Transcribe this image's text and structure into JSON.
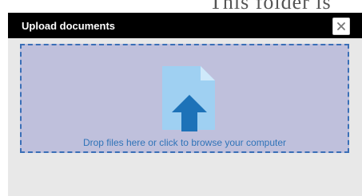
{
  "background": {
    "partial_text": "This folder is"
  },
  "dialog": {
    "title": "Upload documents",
    "close_label": "×"
  },
  "dropzone": {
    "instruction": "Drop files here or click to browse your computer",
    "icon": "upload-file-icon"
  },
  "colors": {
    "titlebar": "#000000",
    "dropzone_bg": "#bfc0dc",
    "dropzone_border": "#3a6fb7",
    "file_icon": "#9fd0f2",
    "arrow": "#1d72b8",
    "instruction_text": "#2f73b8",
    "dialog_bg": "#e8e8e8"
  }
}
